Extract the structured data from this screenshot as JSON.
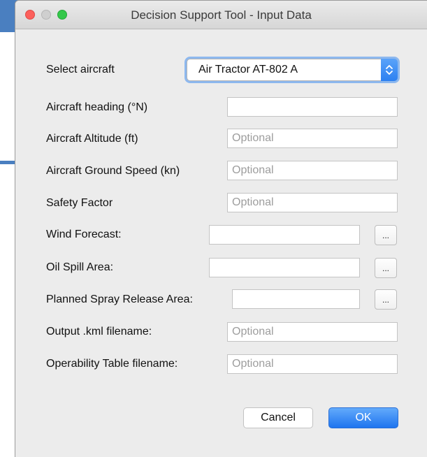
{
  "window": {
    "title": "Decision Support Tool - Input Data"
  },
  "form": {
    "aircraft_label": "Select aircraft",
    "aircraft_value": "Air Tractor AT-802 A",
    "heading_label": "Aircraft heading (°N)",
    "heading_value": "",
    "altitude_label": "Aircraft Altitude (ft)",
    "altitude_placeholder": "Optional",
    "speed_label": "Aircraft Ground Speed (kn)",
    "speed_placeholder": "Optional",
    "safety_label": "Safety Factor",
    "safety_placeholder": "Optional",
    "wind_label": "Wind Forecast:",
    "wind_value": "",
    "oil_label": "Oil Spill Area:",
    "oil_value": "",
    "spray_label": "Planned Spray Release Area:",
    "spray_value": "",
    "kml_label": "Output .kml filename:",
    "kml_placeholder": "Optional",
    "table_label": "Operability Table filename:",
    "table_placeholder": "Optional",
    "browse_label": "..."
  },
  "buttons": {
    "cancel": "Cancel",
    "ok": "OK"
  },
  "colors": {
    "accent": "#2c80f1",
    "close": "#fc605c",
    "maximize": "#34c84a",
    "background_app": "#4a7fc0"
  }
}
